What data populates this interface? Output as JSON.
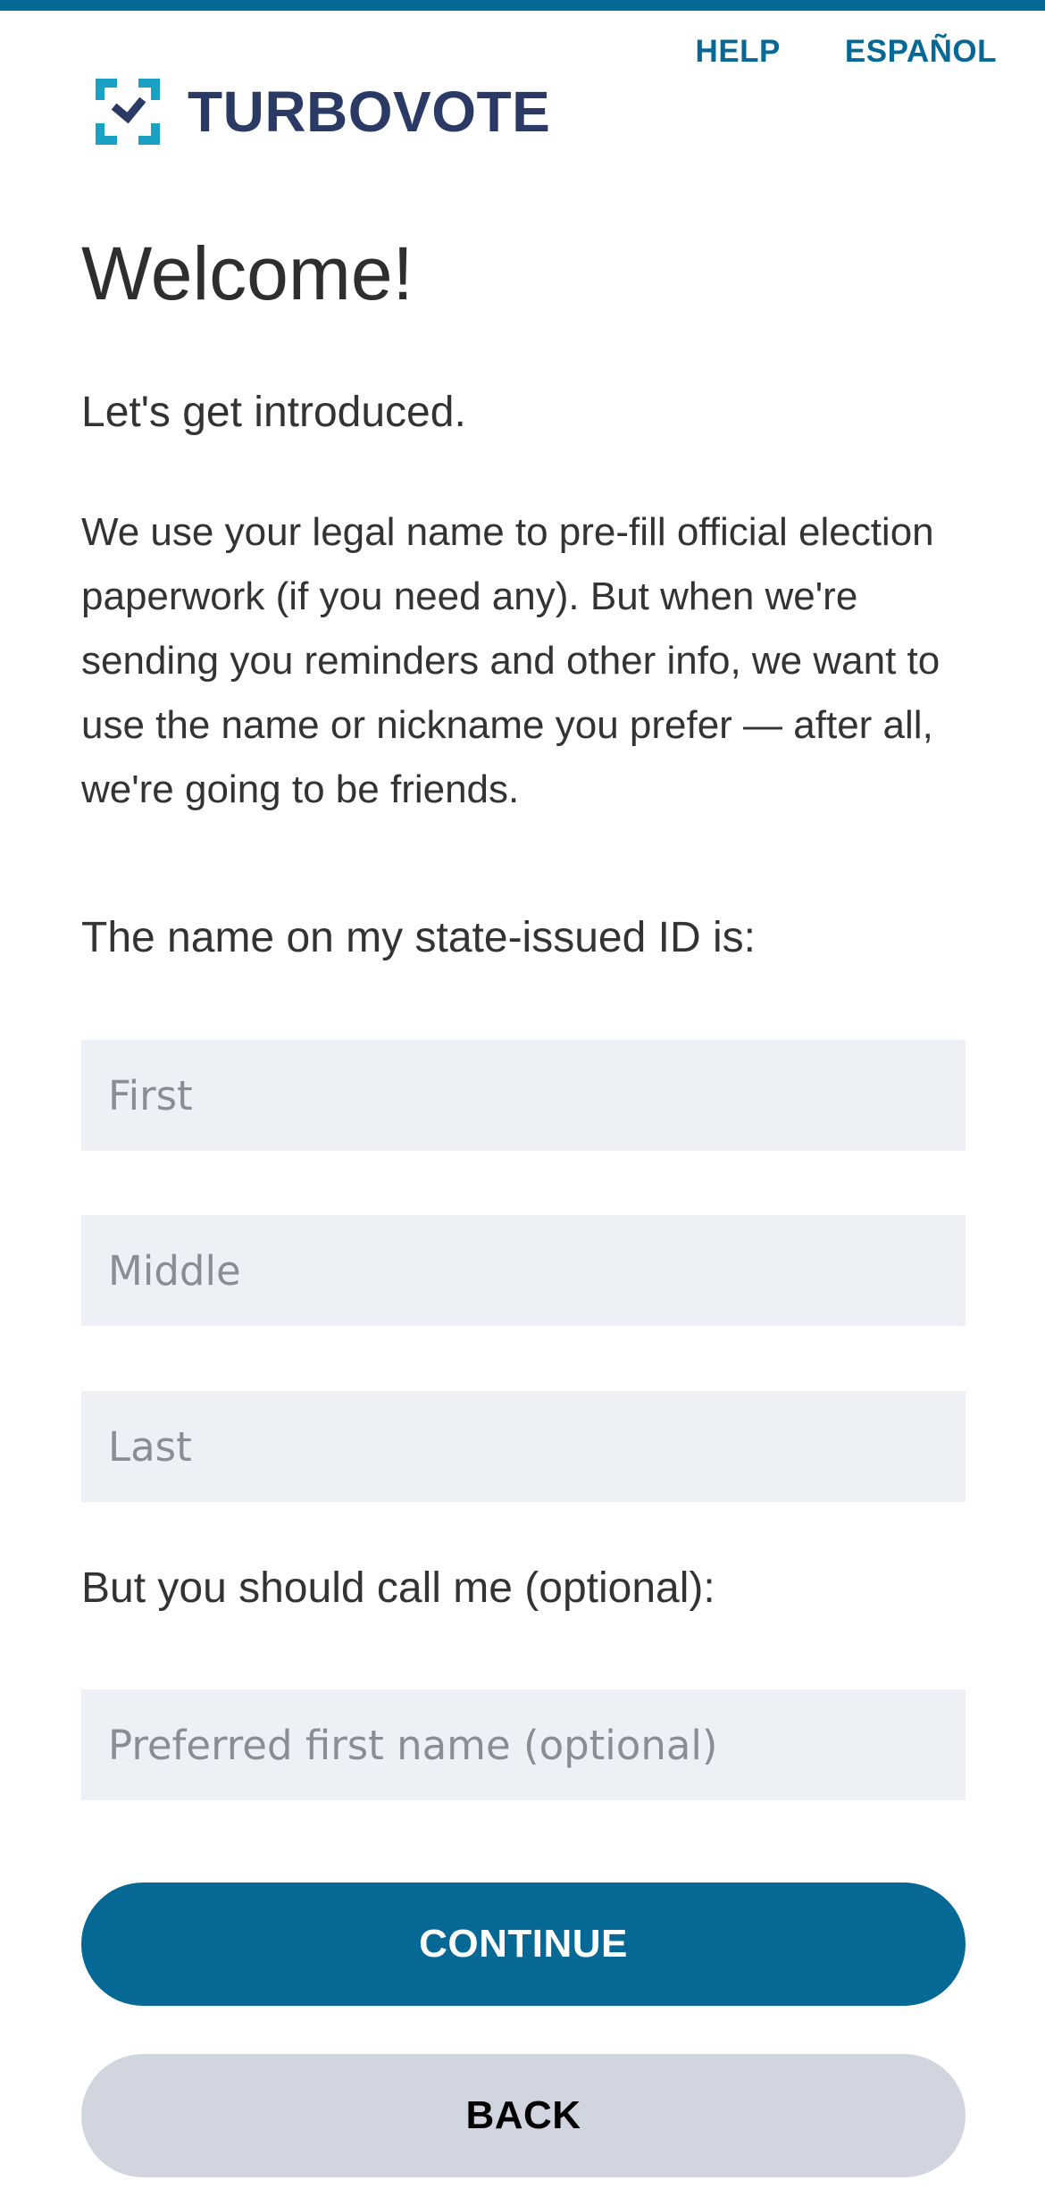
{
  "header": {
    "help_label": "HELP",
    "language_label": "ESPAÑOL",
    "logo_text": "TURBOVOTE",
    "logo_icon": "turbovote-check-brackets-icon"
  },
  "main": {
    "title": "Welcome!",
    "intro": "Let's get introduced.",
    "body": "We use your legal name to pre-fill official election paperwork (if you need any). But when we're sending you reminders and other info, we want to use the name or nickname you prefer — after all, we're going to be friends.",
    "legal_name_label": "The name on my state-issued ID is:",
    "fields": {
      "first_placeholder": "First",
      "first_value": "",
      "middle_placeholder": "Middle",
      "middle_value": "",
      "last_placeholder": "Last",
      "last_value": "",
      "preferred_placeholder": "Preferred first name (optional)",
      "preferred_value": ""
    },
    "preferred_label": "But you should call me (optional):",
    "continue_label": "CONTINUE",
    "back_label": "BACK"
  },
  "colors": {
    "brand_blue": "#066895",
    "logo_navy": "#2a3a64",
    "logo_teal": "#1aa2c4",
    "field_bg": "#edf0f5",
    "back_button_bg": "#d0d5e0"
  }
}
